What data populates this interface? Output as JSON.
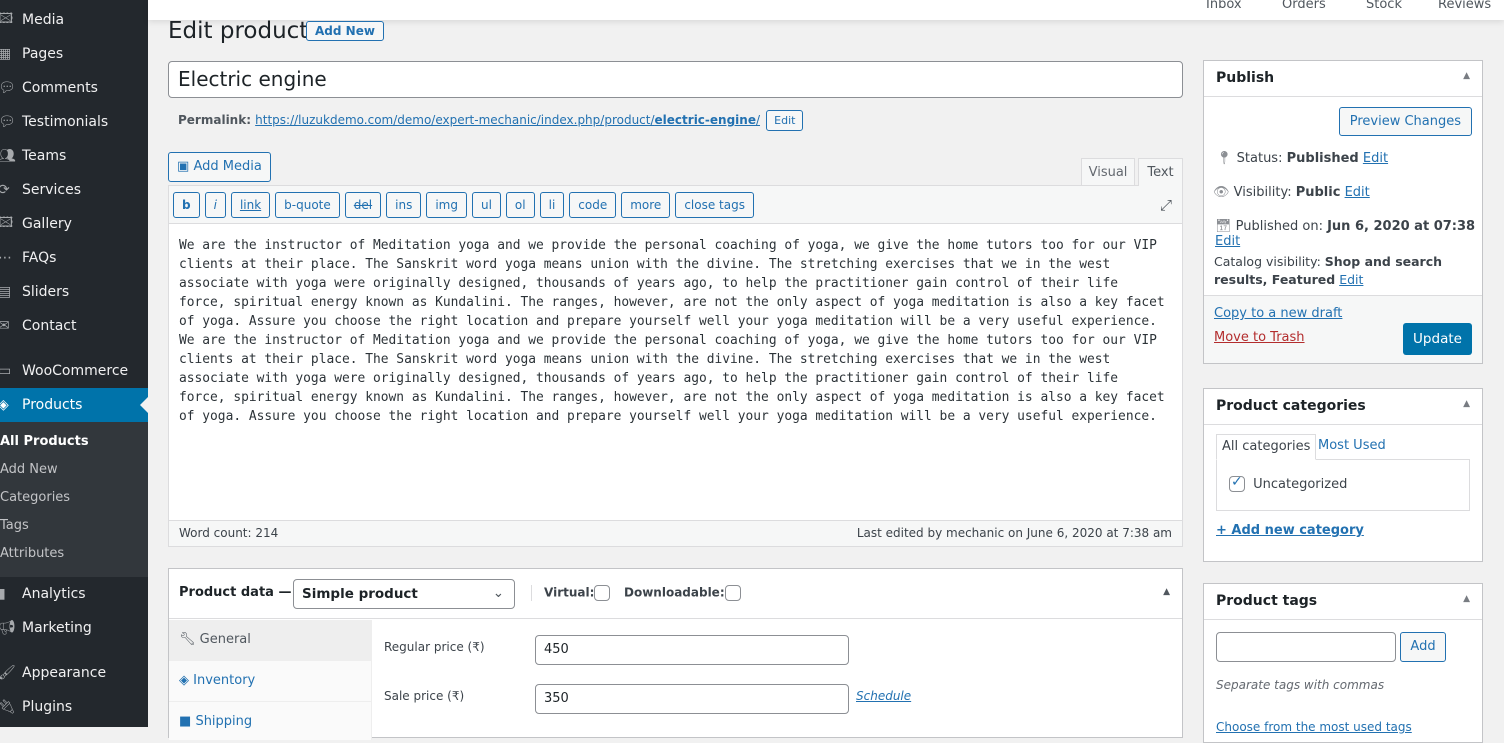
{
  "sidebar": {
    "items": [
      {
        "label": "Media",
        "icon": "media-icon"
      },
      {
        "label": "Pages",
        "icon": "pages-icon"
      },
      {
        "label": "Comments",
        "icon": "comments-icon"
      },
      {
        "label": "Testimonials",
        "icon": "testimonials-icon"
      },
      {
        "label": "Teams",
        "icon": "teams-icon"
      },
      {
        "label": "Services",
        "icon": "services-icon"
      },
      {
        "label": "Gallery",
        "icon": "gallery-icon"
      },
      {
        "label": "FAQs",
        "icon": "faqs-icon"
      },
      {
        "label": "Sliders",
        "icon": "sliders-icon"
      },
      {
        "label": "Contact",
        "icon": "contact-icon"
      },
      {
        "label": "WooCommerce",
        "icon": "woocommerce-icon"
      },
      {
        "label": "Products",
        "icon": "products-icon"
      },
      {
        "label": "Analytics",
        "icon": "analytics-icon"
      },
      {
        "label": "Marketing",
        "icon": "marketing-icon"
      },
      {
        "label": "Appearance",
        "icon": "appearance-icon"
      },
      {
        "label": "Plugins",
        "icon": "plugins-icon"
      }
    ],
    "submenu": [
      "All Products",
      "Add New",
      "Categories",
      "Tags",
      "Attributes"
    ]
  },
  "topbar": {
    "items": [
      "Inbox",
      "Orders",
      "Stock",
      "Reviews"
    ]
  },
  "header": {
    "title": "Edit product",
    "add_new": "Add New"
  },
  "post": {
    "title": "Electric engine",
    "permalink_label": "Permalink:",
    "permalink_base": "https://luzukdemo.com/demo/expert-mechanic/index.php/product/",
    "permalink_slug": "electric-engine",
    "permalink_end": "/",
    "permalink_edit": "Edit"
  },
  "editor": {
    "add_media": "Add Media",
    "tabs": [
      "Visual",
      "Text"
    ],
    "active_tab": "Text",
    "quicktags": [
      "b",
      "i",
      "link",
      "b-quote",
      "del",
      "ins",
      "img",
      "ul",
      "ol",
      "li",
      "code",
      "more",
      "close tags"
    ],
    "content": "We are the instructor of Meditation yoga and we provide the personal coaching of yoga, we give the home tutors too for our VIP clients at their place. The Sanskrit word yoga means union with the divine. The stretching exercises that we in the west associate with yoga were originally designed, thousands of years ago, to help the practitioner gain control of their life force, spiritual energy known as Kundalini. The ranges, however, are not the only aspect of yoga meditation is also a key facet of yoga. Assure you choose the right location and prepare yourself well your yoga meditation will be a very useful experience. We are the instructor of Meditation yoga and we provide the personal coaching of yoga, we give the home tutors too for our VIP clients at their place. The Sanskrit word yoga means union with the divine. The stretching exercises that we in the west associate with yoga were originally designed, thousands of years ago, to help the practitioner gain control of their life force, spiritual energy known as Kundalini. The ranges, however, are not the only aspect of yoga meditation is also a key facet of yoga. Assure you choose the right location and prepare yourself well your yoga meditation will be a very useful experience.",
    "word_count": "Word count: 214",
    "last_edited": "Last edited by mechanic on June 6, 2020 at 7:38 am"
  },
  "product_data": {
    "label": "Product data —",
    "type": "Simple product",
    "virtual": "Virtual:",
    "downloadable": "Downloadable:",
    "tabs": [
      "General",
      "Inventory",
      "Shipping"
    ],
    "regular_price_label": "Regular price (₹)",
    "regular_price": "450",
    "sale_price_label": "Sale price (₹)",
    "sale_price": "350",
    "schedule": "Schedule"
  },
  "publish": {
    "title": "Publish",
    "preview": "Preview Changes",
    "status_label": "Status:",
    "status": "Published",
    "visibility_label": "Visibility:",
    "visibility": "Public",
    "published_label": "Published on:",
    "published": "Jun 6, 2020 at 07:38",
    "catalog_label": "Catalog visibility:",
    "catalog": "Shop and search results, Featured",
    "edit": "Edit",
    "copy": "Copy to a new draft",
    "trash": "Move to Trash",
    "update": "Update"
  },
  "categories": {
    "title": "Product categories",
    "tabs": [
      "All categories",
      "Most Used"
    ],
    "items": [
      {
        "label": "Uncategorized",
        "checked": true
      }
    ],
    "add_new": "+ Add new category"
  },
  "tags": {
    "title": "Product tags",
    "input": "",
    "add": "Add",
    "hint": "Separate tags with commas",
    "choose": "Choose from the most used tags"
  }
}
